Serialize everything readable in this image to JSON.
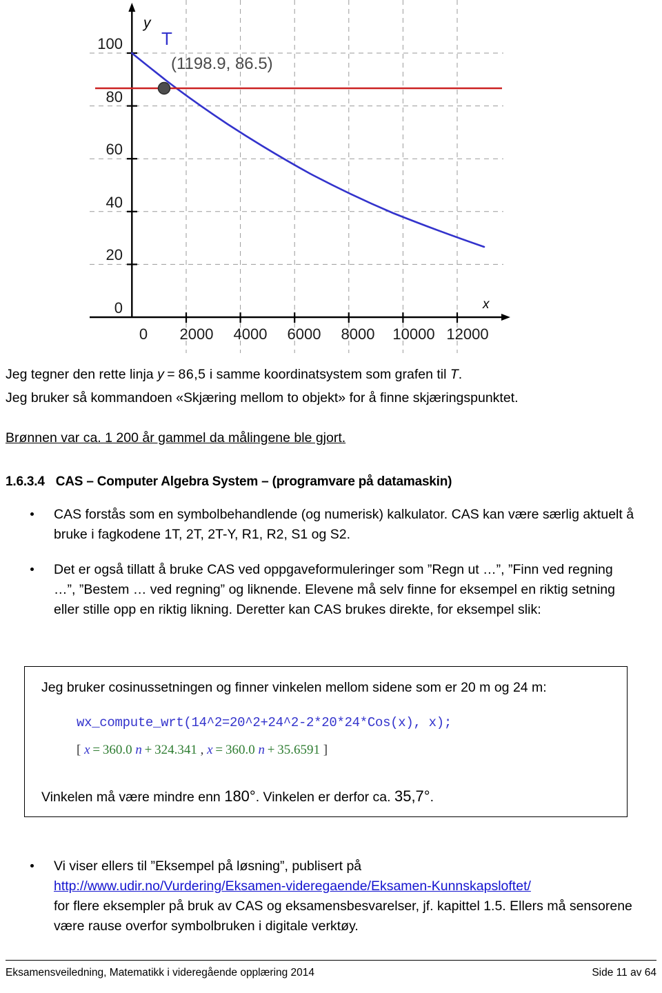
{
  "chart_data": {
    "type": "line",
    "title": "",
    "xlabel": "x",
    "ylabel": "y",
    "xlim": [
      -400,
      13200
    ],
    "ylim": [
      -18,
      112
    ],
    "xticks": [
      0,
      2000,
      4000,
      6000,
      8000,
      10000,
      12000
    ],
    "xtick_labels": [
      "0",
      "2000",
      "4000",
      "6000",
      "8000",
      "10000",
      "12000"
    ],
    "yticks": [
      0,
      20,
      40,
      60,
      80,
      100
    ],
    "ytick_labels": [
      "0",
      "20",
      "40",
      "60",
      "80",
      "100"
    ],
    "grid": true,
    "grid_style": "dashed",
    "legend": "none",
    "series": [
      {
        "name": "T",
        "label": "T",
        "color": "#3333cc",
        "type": "exponential-decay",
        "x": [
          0,
          1000,
          2000,
          3000,
          4000,
          5000,
          6000,
          7000,
          8000,
          9000,
          10000,
          11000,
          12000
        ],
        "y": [
          100,
          88.6,
          78.5,
          69.6,
          61.7,
          54.7,
          48.5,
          42.9,
          38.1,
          33.7,
          29.9,
          26.5,
          23.5
        ]
      },
      {
        "name": "y = 86,5",
        "label": "",
        "color": "#cc2222",
        "type": "horizontal-line",
        "value": 86.5
      }
    ],
    "annotations": [
      {
        "name": "intersection-point",
        "label": "(1198.9, 86.5)",
        "x": 1198.9,
        "y": 86.5,
        "marker": "filled-circle",
        "marker_color": "#4d4d4d"
      },
      {
        "name": "curve-label",
        "label": "T",
        "x": 700,
        "y": 108,
        "color": "#3333cc"
      }
    ]
  },
  "body": {
    "intro_line1_pre": "Jeg tegner den rette linja ",
    "intro_line1_math_var": "y",
    "intro_line1_math_rest": " = 86,5",
    "intro_line1_post": " i samme koordinatsystem som grafen til ",
    "intro_line1_math_T": "T",
    "intro_line1_end": ".",
    "intro_line2": "Jeg bruker så kommandoen «Skjæring mellom to objekt» for å finne skjæringspunktet.",
    "answer_underlined": "Brønnen var ca. 1 200 år gammel da målingene ble gjort."
  },
  "heading": {
    "number": "1.6.3.4",
    "text": "CAS – Computer Algebra System – (programvare på datamaskin)"
  },
  "bullets": [
    {
      "text": "CAS forstås som en symbolbehandlende (og numerisk) kalkulator. CAS kan være særlig aktuelt å bruke i fagkodene 1T, 2T, 2T-Y, R1, R2, S1 og S2."
    },
    {
      "text": "Det er også tillatt å bruke CAS ved oppgaveformuleringer som ”Regn ut …”, ”Finn ved regning …”, ”Bestem … ved regning” og liknende. Elevene må selv finne for eksempel en riktig setning eller stille opp en riktig likning. Deretter kan CAS brukes direkte, for eksempel slik:"
    }
  ],
  "cas_box": {
    "caption": "Jeg bruker cosinussetningen og finner vinkelen mellom sidene som er 20 m og 24 m:",
    "code_line": "wx_compute_wrt(14^2=20^2+24^2-2*20*24*Cos(x), x);",
    "result": {
      "open_bracket": "[ ",
      "var1": "x",
      "eq1": " = ",
      "num1": "360.0",
      "var_n1": " n",
      "plus1": " + ",
      "num2": "324.341",
      "comma": " , ",
      "var2": "x",
      "eq2": " = ",
      "num3": "360.0",
      "var_n2": " n",
      "plus2": " + ",
      "num4": "35.6591",
      "close_bracket": " ]"
    },
    "conclusion_pre": "Vinkelen må være mindre enn ",
    "conclusion_angle1": "180°",
    "conclusion_mid": ". Vinkelen er derfor ca. ",
    "conclusion_angle2": "35,7°",
    "conclusion_end": "."
  },
  "last_bullet": {
    "line1": "Vi viser ellers til ”Eksempel på løsning”, publisert på",
    "url": "http://www.udir.no/Vurdering/Eksamen-videregaende/Eksamen-Kunnskapsloftet/",
    "line3": "for flere eksempler på bruk av CAS og eksamensbesvarelser, jf. kapittel 1.5. Ellers må sensorene være rause overfor symbolbruken i digitale verktøy."
  },
  "footer": {
    "left": "Eksamensveiledning, Matematikk i videregående opplæring 2014",
    "right": "Side 11 av 64"
  }
}
